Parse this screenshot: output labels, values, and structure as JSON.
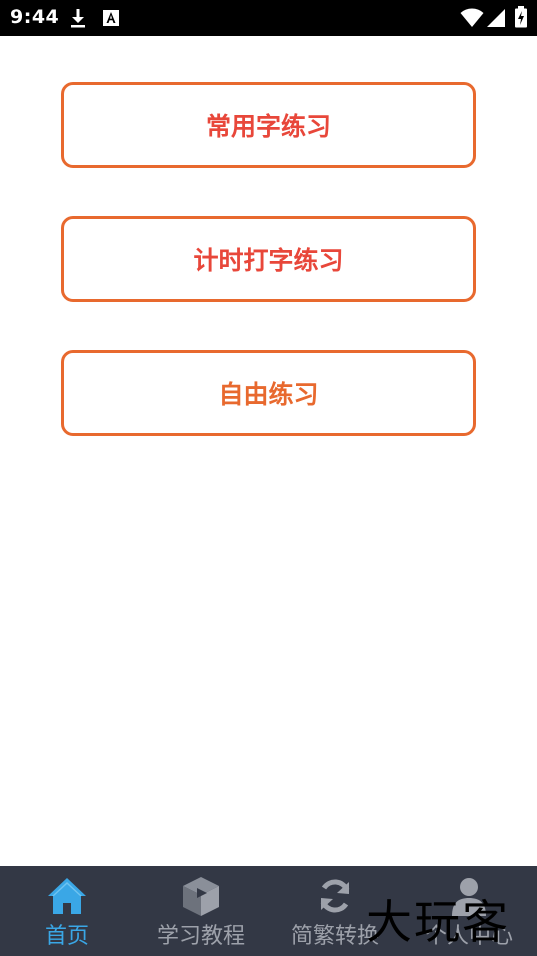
{
  "status_bar": {
    "time": "9:44",
    "icons": [
      "download-icon",
      "a-notification-icon",
      "wifi-icon",
      "signal-icon",
      "battery-icon"
    ]
  },
  "buttons": [
    {
      "label": "常用字练习",
      "color": "#e8473a"
    },
    {
      "label": "计时打字练习",
      "color": "#e8473a"
    },
    {
      "label": "自由练习",
      "color": "#e8692e"
    }
  ],
  "colors": {
    "button_border": "#e8692e",
    "nav_background": "#333845",
    "nav_active": "#3aa7e6",
    "nav_inactive": "#9da1aa"
  },
  "bottom_nav": {
    "items": [
      {
        "label": "首页",
        "icon": "home-icon",
        "active": true
      },
      {
        "label": "学习教程",
        "icon": "play-cube-icon",
        "active": false
      },
      {
        "label": "简繁转换",
        "icon": "refresh-icon",
        "active": false
      },
      {
        "label": "个人中心",
        "icon": "user-icon",
        "active": false
      }
    ]
  },
  "watermark": "大玩客"
}
